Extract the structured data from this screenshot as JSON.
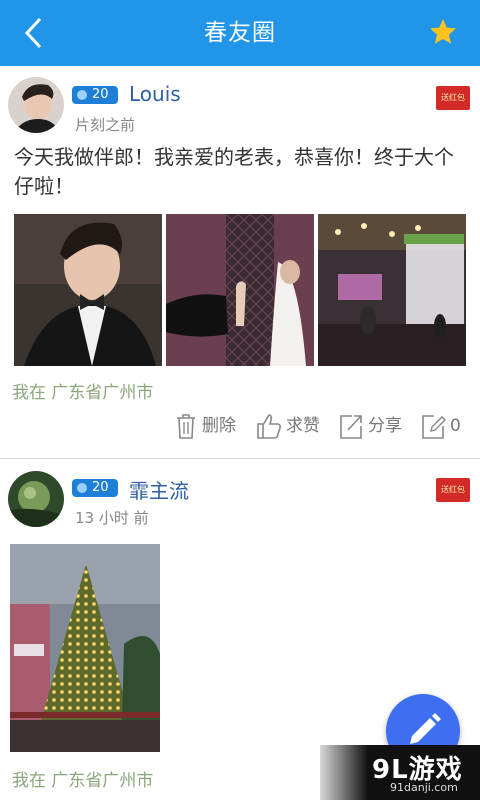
{
  "header": {
    "title": "春友圈",
    "back_icon": "back-arrow-icon",
    "favorite_icon": "star-icon",
    "accent": "#2196e8"
  },
  "posts": [
    {
      "level": "20",
      "username": "Louis",
      "time": "片刻之前",
      "red_packet_label": "送红包",
      "text": "今天我做伴郎！我亲爱的老表，恭喜你！终于大个仔啦！",
      "location": "我在 广东省广州市",
      "actions": {
        "delete": "删除",
        "like": "求赞",
        "share": "分享",
        "comment_count": "0"
      }
    },
    {
      "level": "20",
      "username": "霏主流",
      "time": "13 小时 前",
      "red_packet_label": "送红包",
      "location": "我在 广东省广州市"
    }
  ],
  "fab": {
    "icon": "pencil-icon"
  },
  "watermark": {
    "logo": "9L游戏",
    "site": "91danji.com"
  }
}
